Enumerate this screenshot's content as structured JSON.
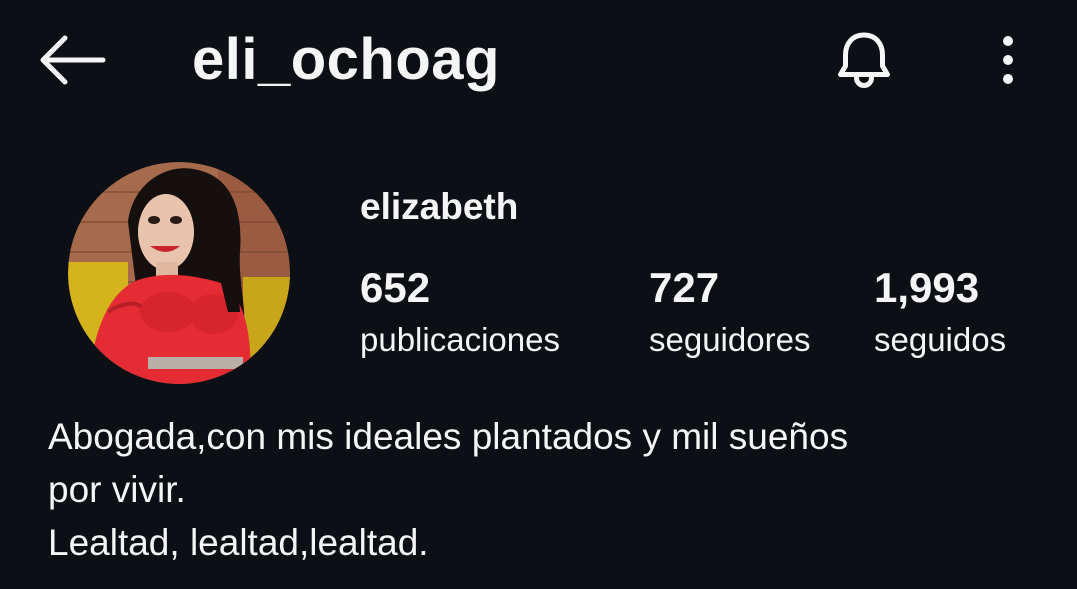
{
  "header": {
    "username": "eli_ochoag",
    "back_icon": "arrow-left-icon",
    "bell_icon": "bell-icon",
    "more_icon": "more-vertical-icon"
  },
  "profile": {
    "display_name": "elizabeth",
    "stats": {
      "posts": {
        "count": "652",
        "label": "publicaciones"
      },
      "followers": {
        "count": "727",
        "label": "seguidores"
      },
      "following": {
        "count": "1,993",
        "label": "seguidos"
      }
    },
    "bio": {
      "line1": "Abogada,con mis ideales plantados y mil sueños",
      "line2": "por vivir.",
      "line3": "Lealtad, lealtad,lealtad."
    }
  },
  "colors": {
    "background": "#0c1014",
    "text": "#f5f5f5"
  }
}
